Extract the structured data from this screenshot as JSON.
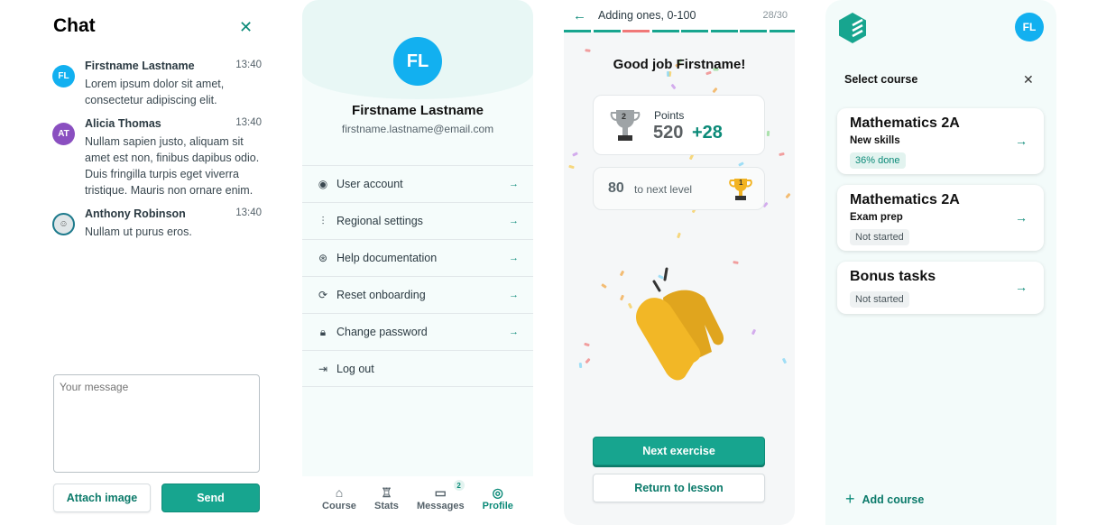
{
  "chat": {
    "title": "Chat",
    "messages": [
      {
        "initials": "FL",
        "name": "Firstname Lastname",
        "time": "13:40",
        "text": "Lorem ipsum dolor sit amet, consectetur adipiscing elit.",
        "color": "#12b0f0"
      },
      {
        "initials": "AT",
        "name": "Alicia Thomas",
        "time": "13:40",
        "text": "Nullam sapien justo, aliquam sit amet est non, finibus dapibus odio. Duis fringilla turpis eget viverra tristique. Mauris non ornare enim.",
        "color": "#8a4fc0"
      },
      {
        "initials": "",
        "name": "Anthony Robinson",
        "time": "13:40",
        "text": "Nullam ut purus eros.",
        "color": "#e0e6e8"
      }
    ],
    "placeholder": "Your message",
    "attach_label": "Attach image",
    "send_label": "Send"
  },
  "profile": {
    "initials": "FL",
    "name": "Firstname Lastname",
    "email": "firstname.lastname@email.com",
    "menu": [
      {
        "label": "User account",
        "icon": "user-circle-icon"
      },
      {
        "label": "Regional settings",
        "icon": "sliders-icon"
      },
      {
        "label": "Help documentation",
        "icon": "lifebuoy-icon"
      },
      {
        "label": "Reset onboarding",
        "icon": "refresh-icon"
      },
      {
        "label": "Change password",
        "icon": "lock-icon"
      },
      {
        "label": "Log out",
        "icon": "logout-icon"
      }
    ],
    "nav": [
      {
        "label": "Course",
        "icon": "home-icon"
      },
      {
        "label": "Stats",
        "icon": "trophy-icon"
      },
      {
        "label": "Messages",
        "icon": "message-icon",
        "badge": "2"
      },
      {
        "label": "Profile",
        "icon": "user-icon",
        "active": true
      }
    ]
  },
  "exercise": {
    "title": "Adding ones, 0-100",
    "progress": "28/30",
    "segments": [
      "correct",
      "correct",
      "wrong",
      "correct",
      "correct",
      "correct",
      "correct",
      "correct"
    ],
    "heading": "Good job Firstname!",
    "points_label": "Points",
    "points": "520",
    "gained": "+28",
    "trophy_rank": "2",
    "next_level_value": "80",
    "next_level_text": "to next level",
    "next_trophy_rank": "1",
    "next_label": "Next exercise",
    "return_label": "Return to lesson",
    "accent": "#17a58f",
    "wrong_color": "#f07878"
  },
  "course": {
    "initials": "FL",
    "heading": "Select course",
    "cards": [
      {
        "title": "Mathematics 2A",
        "subtitle": "New skills",
        "tag": "36% done",
        "done": true
      },
      {
        "title": "Mathematics 2A",
        "subtitle": "Exam prep",
        "tag": "Not started"
      },
      {
        "title": "Bonus tasks",
        "subtitle": "",
        "tag": "Not started"
      }
    ],
    "add_label": "Add course"
  }
}
